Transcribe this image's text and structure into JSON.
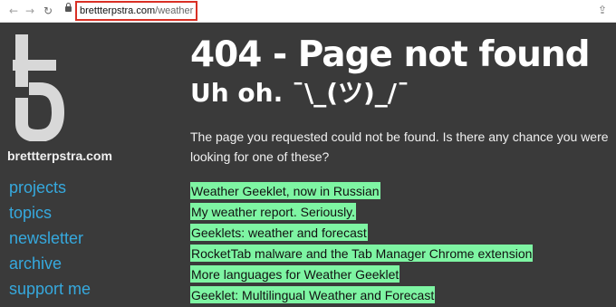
{
  "browser": {
    "url_host": "brettterpstra.com",
    "url_path": "/weather",
    "icons": [
      "back-arrow-icon",
      "forward-arrow-icon",
      "reload-icon",
      "lock-icon",
      "share-icon"
    ]
  },
  "sidebar": {
    "site_name": "brettterpstra.com",
    "nav": [
      "projects",
      "topics",
      "newsletter",
      "archive",
      "support me"
    ]
  },
  "main": {
    "title": "404 - Page not found",
    "subtitle": "Uh oh. ¯\\_(ツ)_/¯",
    "message": "The page you requested could not be found. Is there any chance you were looking for one of these?",
    "suggestions": [
      "Weather Geeklet, now in Russian",
      "My weather report. Seriously.",
      "Geeklets: weather and forecast",
      "RocketTab malware and the Tab Manager Chrome extension",
      "More languages for Weather Geeklet",
      "Geeklet: Multilingual Weather and Forecast"
    ]
  },
  "colors": {
    "background": "#3a3a3a",
    "link": "#36a9de",
    "highlight": "#7ef5a3",
    "url_outline": "#d93025"
  }
}
